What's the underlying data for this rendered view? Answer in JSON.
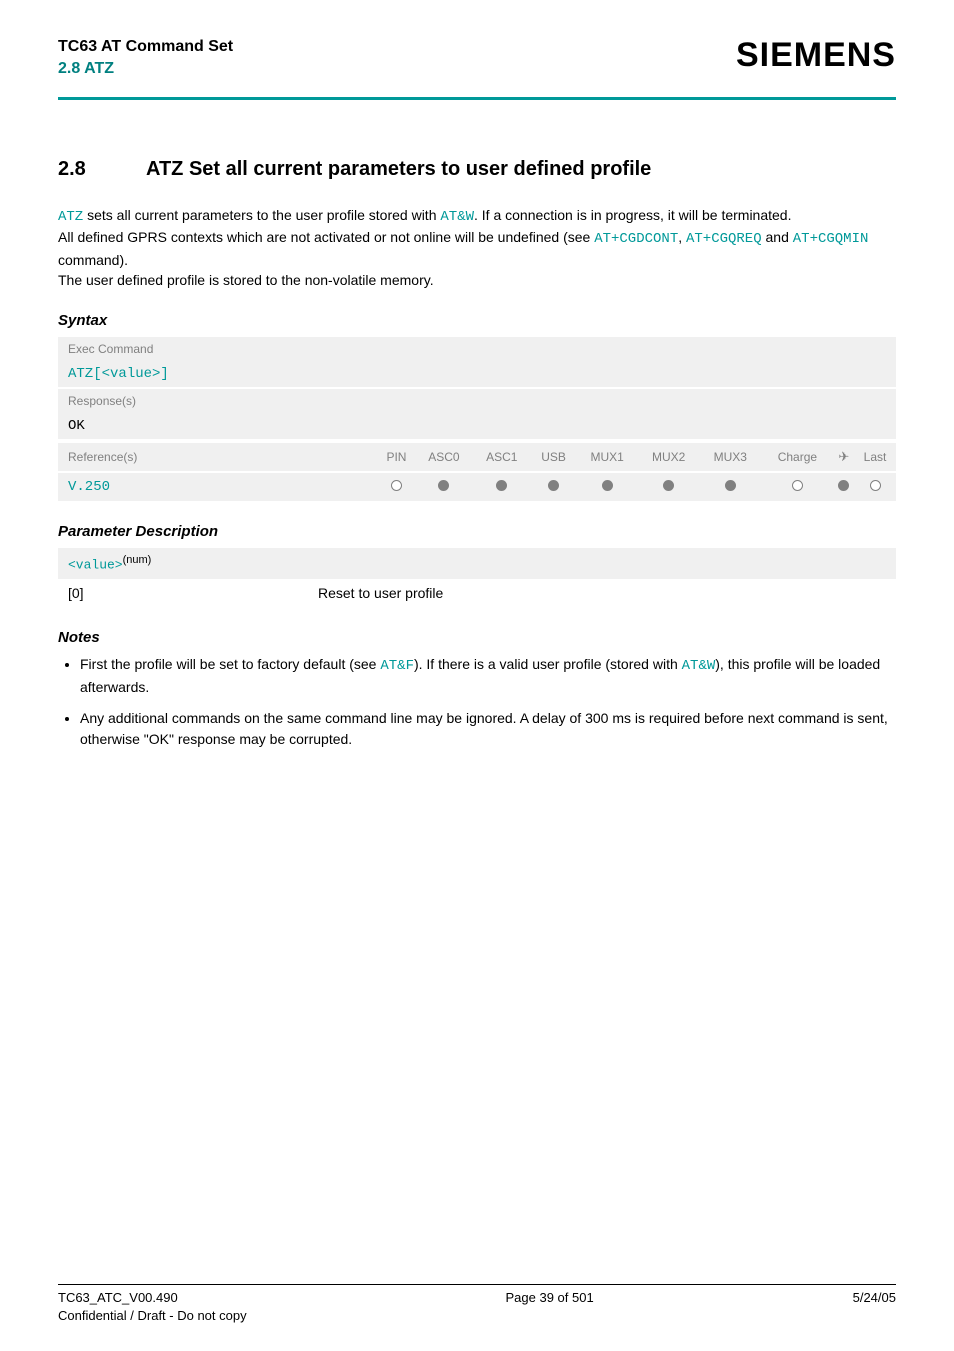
{
  "header": {
    "doc_title": "TC63 AT Command Set",
    "doc_subtitle": "2.8 ATZ",
    "brand": "SIEMENS"
  },
  "section": {
    "number": "2.8",
    "title": "ATZ   Set all current parameters to user defined profile"
  },
  "intro": {
    "p1_a": "ATZ",
    "p1_b": " sets all current parameters to the user profile stored with ",
    "p1_c": "AT&W",
    "p1_d": ". If a connection is in progress, it will be terminated.",
    "p2_a": "All defined GPRS contexts which are not activated or not online will be undefined (see ",
    "p2_b": "AT+CGDCONT",
    "p2_c": ", ",
    "p2_d": "AT+CGQREQ",
    "p2_e": " and ",
    "p2_f": "AT+CGQMIN",
    "p2_g": " command).",
    "p3": "The user defined profile is stored to the non-volatile memory."
  },
  "syntax": {
    "label": "Syntax",
    "exec_label": "Exec Command",
    "exec_cmd_a": "ATZ[",
    "exec_cmd_b": "<value>",
    "exec_cmd_c": "]",
    "response_label": "Response(s)",
    "response_value": "OK",
    "ref_label": "Reference(s)",
    "ref_value": "V.250",
    "cols": [
      "PIN",
      "ASC0",
      "ASC1",
      "USB",
      "MUX1",
      "MUX2",
      "MUX3",
      "Charge",
      "✈",
      "Last"
    ],
    "states": [
      "empty",
      "filled",
      "filled",
      "filled",
      "filled",
      "filled",
      "filled",
      "empty",
      "filled",
      "empty"
    ]
  },
  "param": {
    "label": "Parameter Description",
    "value_token": "<value>",
    "value_sup": "(num)",
    "row_key": "[0]",
    "row_desc": "Reset to user profile"
  },
  "notes": {
    "label": "Notes",
    "n1_a": "First the profile will be set to factory default (see ",
    "n1_b": "AT&F",
    "n1_c": "). If there is a valid user profile (stored with ",
    "n1_d": "AT&W",
    "n1_e": "), this profile will be loaded afterwards.",
    "n2": "Any additional commands on the same command line may be ignored. A delay of 300 ms is required before next command is sent, otherwise \"OK\" response may be corrupted."
  },
  "footer": {
    "left1": "TC63_ATC_V00.490",
    "left2": "Confidential / Draft - Do not copy",
    "center": "Page 39 of 501",
    "right": "5/24/05"
  }
}
